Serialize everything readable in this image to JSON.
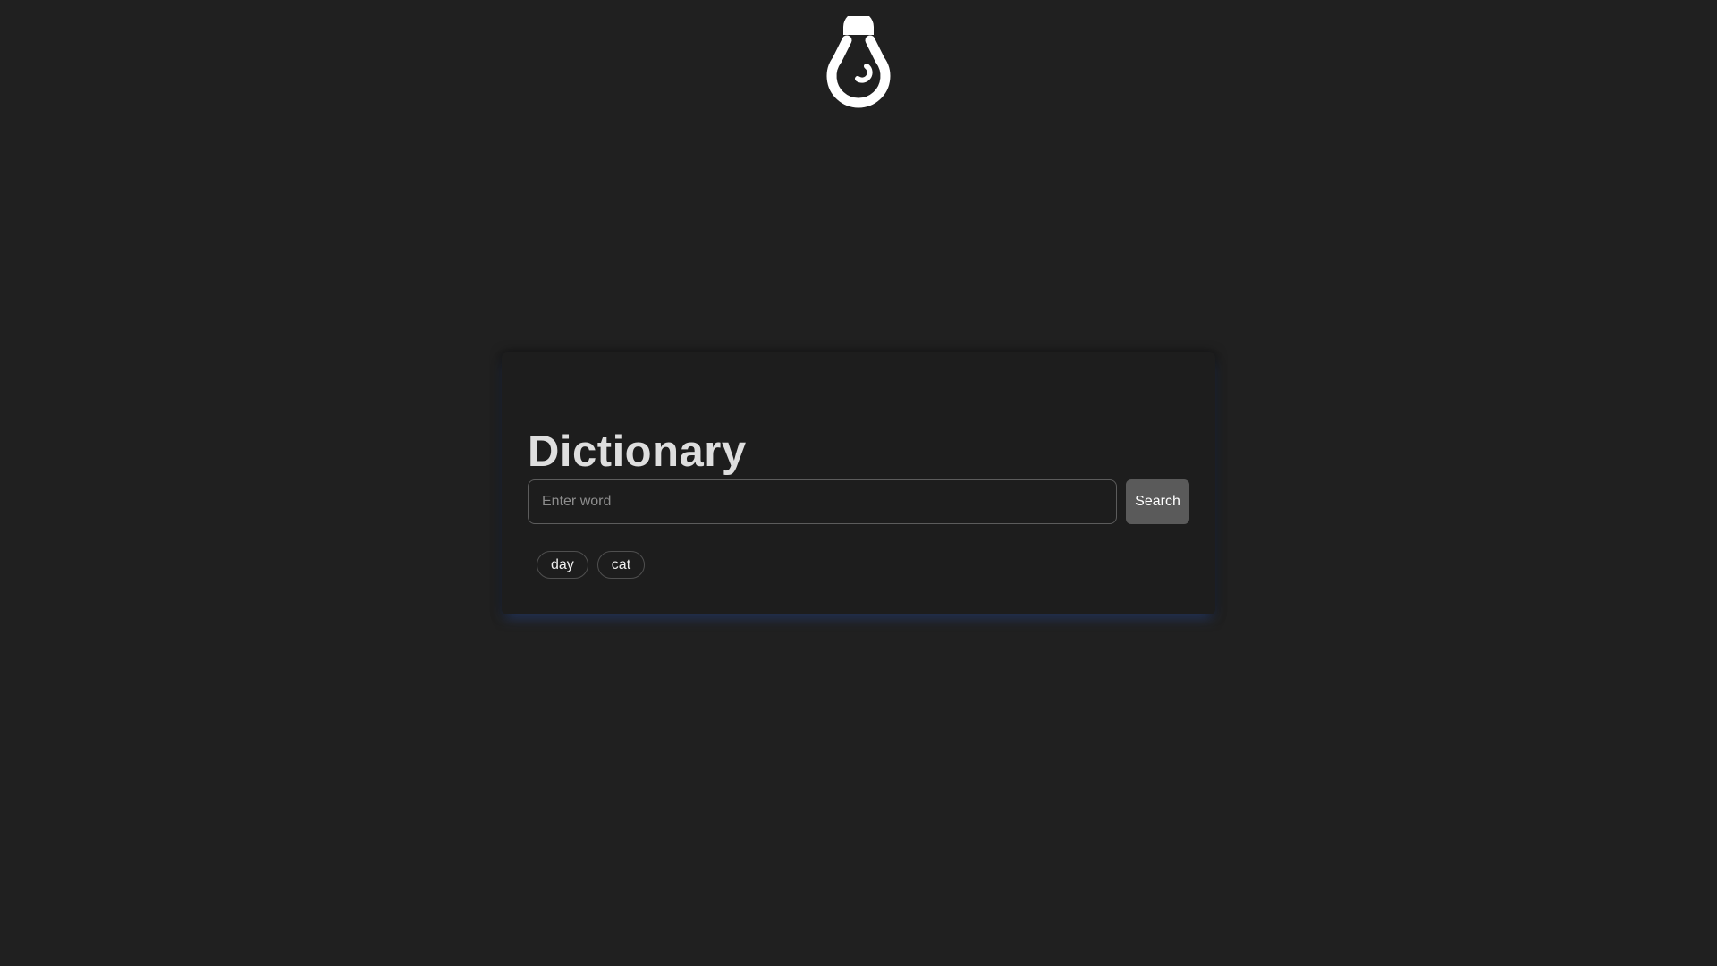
{
  "header": {
    "theme_toggle_icon": "lightbulb-icon",
    "icon_color": "#ffffff"
  },
  "dictionary": {
    "title": "Dictionary",
    "search": {
      "placeholder": "Enter word",
      "value": "",
      "button_label": "Search"
    },
    "suggestions": [
      "day",
      "cat"
    ]
  },
  "colors": {
    "background": "#202020",
    "card": "#1d1d1d",
    "button": "#5a5a5a",
    "card_glow": "#304e96"
  }
}
